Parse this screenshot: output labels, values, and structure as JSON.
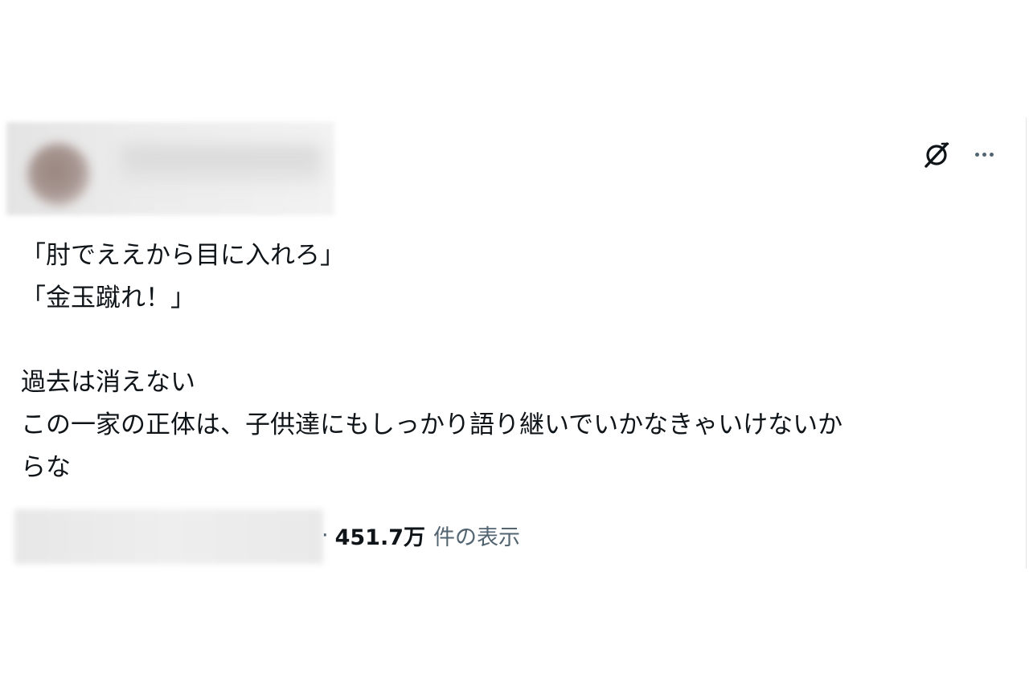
{
  "tweet": {
    "lines": [
      "「肘でええから目に入れろ」",
      "「金玉蹴れ！」",
      "過去は消えない",
      "この一家の正体は、子供達にもしっかり語り継いでいかなきゃいけないか",
      "らな"
    ]
  },
  "meta": {
    "separator": "·",
    "views_count": "451.7万",
    "views_label": "件の表示"
  },
  "icons": {
    "grok": "grok-icon",
    "more": "more-icon"
  },
  "colors": {
    "text": "#0f1419",
    "secondary": "#536471"
  }
}
